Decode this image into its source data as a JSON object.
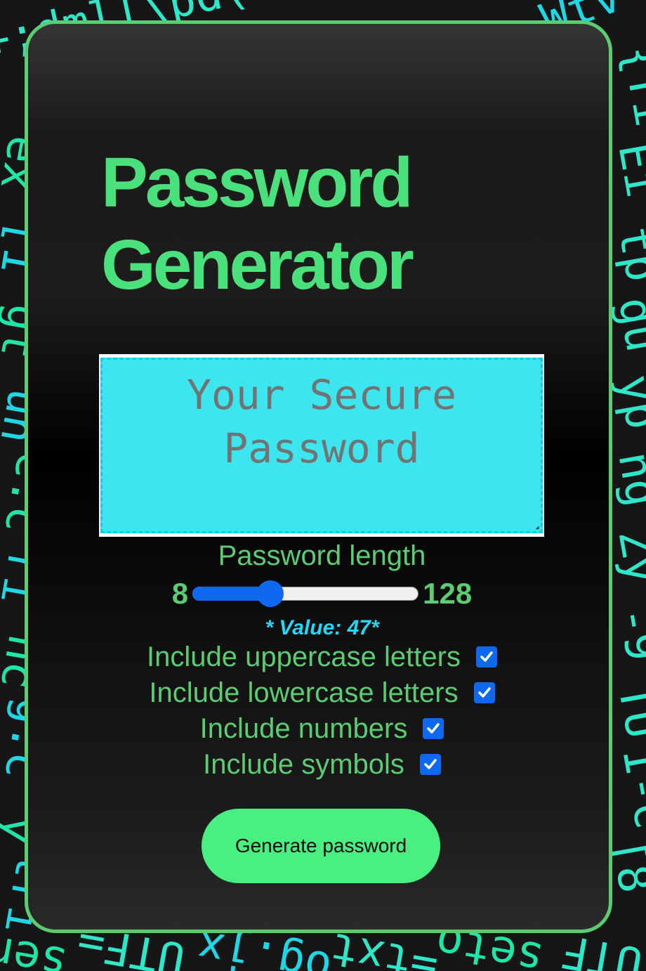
{
  "app": {
    "title_line1": "Password",
    "title_line2": "Generator"
  },
  "password_box": {
    "placeholder": "Your Secure Password",
    "value": ""
  },
  "length": {
    "label": "Password length",
    "min_label": "8",
    "max_label": "128",
    "min": 8,
    "max": 128,
    "value": 47,
    "value_text": "* Value: 47*"
  },
  "options": [
    {
      "label": "Include uppercase letters",
      "checked": true
    },
    {
      "label": "Include lowercase letters",
      "checked": true
    },
    {
      "label": "Include numbers",
      "checked": true
    },
    {
      "label": "Include symbols",
      "checked": true
    }
  ],
  "generate_button": {
    "label": "Generate password"
  },
  "colors": {
    "accent_green": "#4ae07c",
    "border_green": "#5ccc73",
    "button_green": "#4af07f",
    "cyan_box": "#3de6ef",
    "value_cyan": "#26d6f5",
    "checkbox_blue": "#0f69ef"
  },
  "background_glyphs": [
    {
      "text": "+;dml[\\pd(\"ribe",
      "color": "#2ee6c8"
    },
    {
      "text": "Wtv",
      "color": "#1fd6e6"
    },
    {
      "text": "{Ti",
      "color": "#2ee6c8"
    },
    {
      "text": "ex",
      "color": "#1fe6a8"
    },
    {
      "text": "Ei",
      "color": "#2ee6c8"
    },
    {
      "text": "[1",
      "color": "#1fd6e6"
    },
    {
      "text": "tp",
      "color": "#2ee6c8"
    },
    {
      "text": "gt",
      "color": "#1fe6a8"
    },
    {
      "text": "gu",
      "color": "#2ee6c8"
    },
    {
      "text": "un",
      "color": "#1fd6e6"
    },
    {
      "text": "yp",
      "color": "#2ee6c8"
    },
    {
      "text": "e.c",
      "color": "#1fe6a8"
    },
    {
      "text": "ng",
      "color": "#2ee6c8"
    },
    {
      "text": "ri",
      "color": "#1fd6e6"
    },
    {
      "text": "Zy",
      "color": "#2ee6c8"
    },
    {
      "text": "nc",
      "color": "#1fe6a8"
    },
    {
      "text": "-9",
      "color": "#2ee6c8"
    },
    {
      "text": "g.c",
      "color": "#1fd6e6"
    },
    {
      "text": "TU",
      "color": "#2ee6c8"
    },
    {
      "text": "\"y",
      "color": "#1fe6a8"
    },
    {
      "text": "I-c",
      "color": "#2ee6c8"
    },
    {
      "text": "tri",
      "color": "#1fd6e6"
    },
    {
      "text": "[8",
      "color": "#2ee6c8"
    },
    {
      "text": "sen",
      "color": "#1fe6a8"
    },
    {
      "text": "UTF=",
      "color": "#2ee6c8"
    },
    {
      "text": "og.jx",
      "color": "#1fd6e6"
    },
    {
      "text": "=txt",
      "color": "#2ee6c8"
    },
    {
      "text": "seto",
      "color": "#1fe6a8"
    },
    {
      "text": "UTF",
      "color": "#2ee6c8"
    }
  ]
}
